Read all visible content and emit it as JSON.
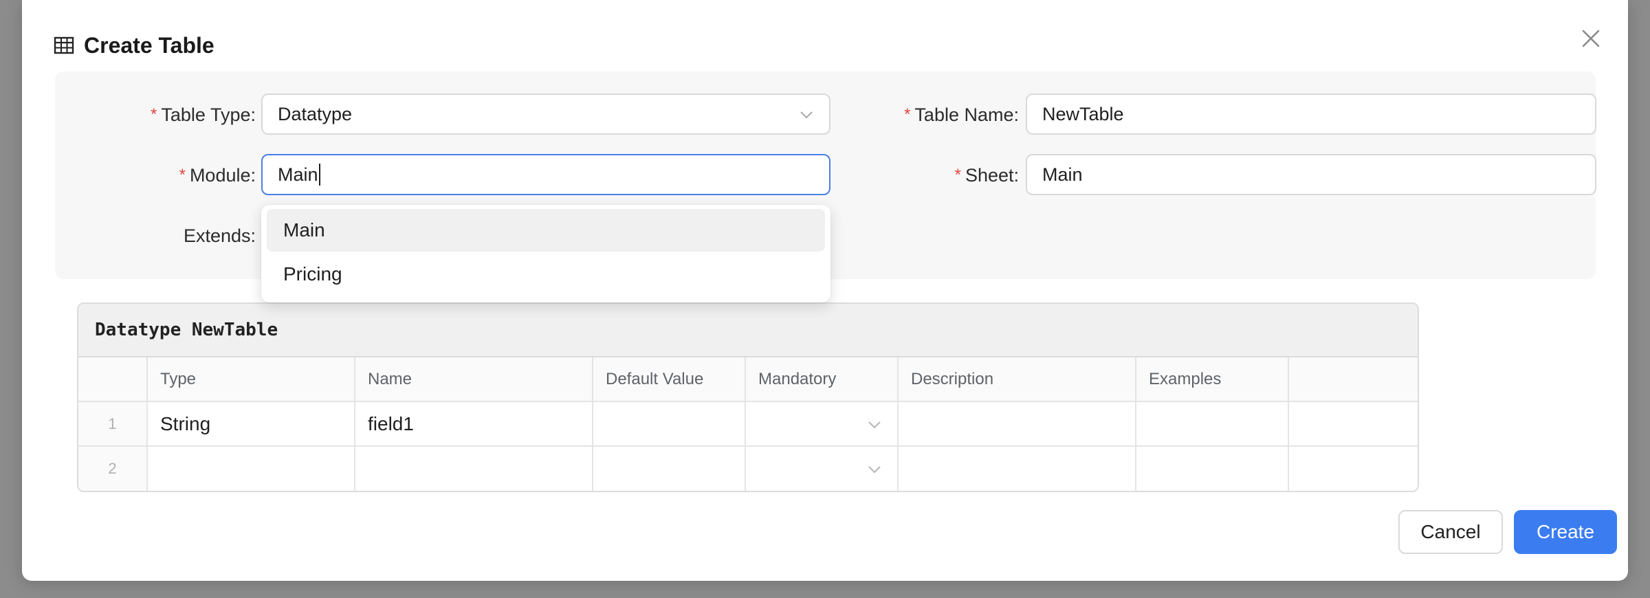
{
  "dialog": {
    "title": "Create Table",
    "title_icon": "table-icon",
    "close_icon": "close-icon"
  },
  "form": {
    "required_mark": "*",
    "table_type": {
      "label": "Table Type:",
      "value": "Datatype",
      "required": true
    },
    "table_name": {
      "label": "Table Name:",
      "value": "NewTable",
      "required": true
    },
    "module": {
      "label": "Module:",
      "value": "Main",
      "required": true,
      "focused": true
    },
    "sheet": {
      "label": "Sheet:",
      "value": "Main",
      "required": true
    },
    "extends": {
      "label": "Extends:",
      "required": false
    }
  },
  "module_dropdown": {
    "options": [
      {
        "label": "Main",
        "highlighted": true
      },
      {
        "label": "Pricing",
        "highlighted": false
      }
    ]
  },
  "grid": {
    "title": "Datatype NewTable",
    "columns": [
      "",
      "Type",
      "Name",
      "Default Value",
      "Mandatory",
      "Description",
      "Examples",
      ""
    ],
    "rows": [
      {
        "num": "1",
        "type": "String",
        "name": "field1",
        "default_value": "",
        "mandatory": "",
        "description": "",
        "examples": ""
      },
      {
        "num": "2",
        "type": "",
        "name": "",
        "default_value": "",
        "mandatory": "",
        "description": "",
        "examples": ""
      }
    ]
  },
  "buttons": {
    "cancel": "Cancel",
    "create": "Create"
  },
  "colors": {
    "accent": "#3b7cf0",
    "required": "#e0463b",
    "focus_border": "#4a7fe6",
    "backdrop": "#8c8c8c"
  }
}
